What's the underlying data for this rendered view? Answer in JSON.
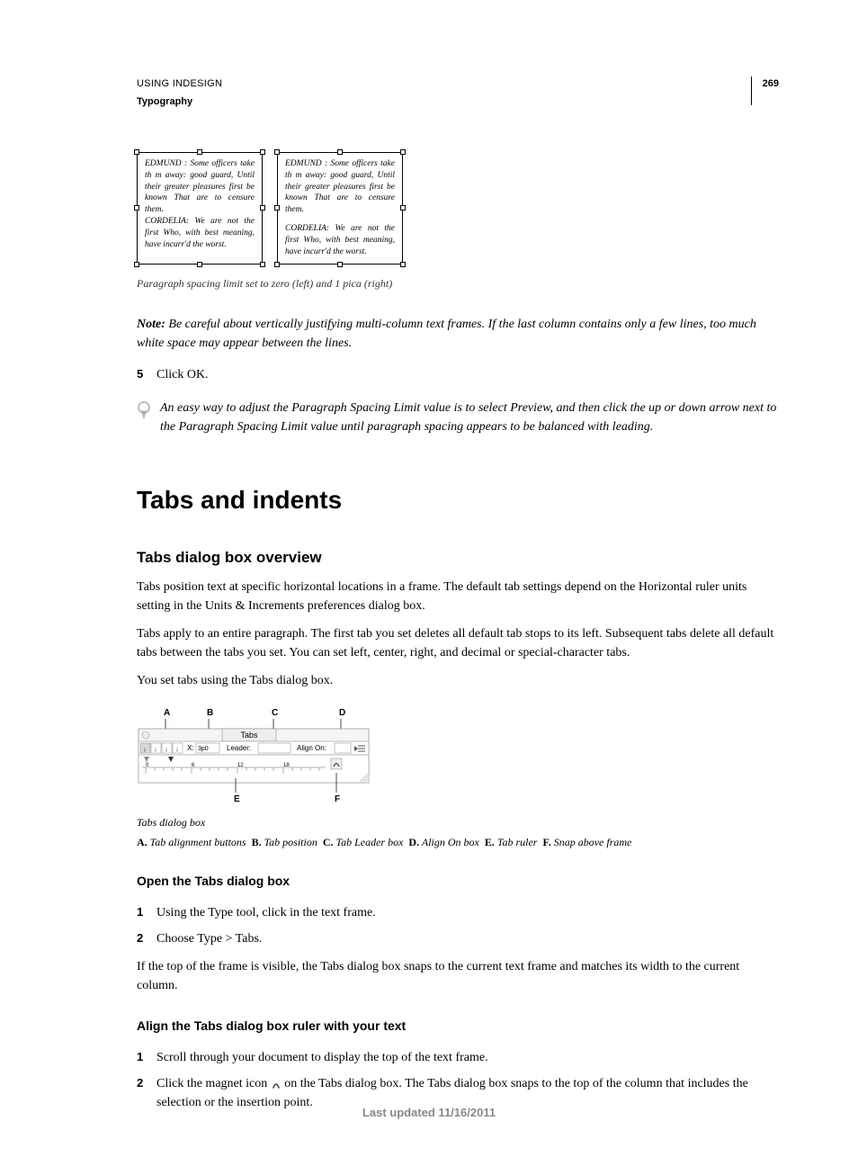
{
  "header": {
    "doc_title": "USING INDESIGN",
    "section_title": "Typography",
    "page_number": "269"
  },
  "figure1": {
    "frame1_text": "EDMUND : Some officers take th m away: good guard, Until their greater pleasures first be known That are to censure them.\nCORDELIA: We are not the first Who, with best meaning, have incurr'd the worst.",
    "frame2_para1": "EDMUND : Some officers take th m away: good guard, Until their greater pleasures first be known That are to censure them.",
    "frame2_para2": "CORDELIA: We are not the first Who, with best meaning, have incurr'd the worst.",
    "caption": "Paragraph spacing limit set to zero (left) and 1 pica (right)"
  },
  "note": {
    "label": "Note:",
    "text": "Be careful about vertically justifying multi-column text frames. If the last column contains only a few lines, too much white space may appear between the lines."
  },
  "step5": {
    "num": "5",
    "text": "Click OK."
  },
  "tip": {
    "text": "An easy way to adjust the Paragraph Spacing Limit value is to select Preview, and then click the up or down arrow next to the Paragraph Spacing Limit value until paragraph spacing appears to be balanced with leading."
  },
  "h1": "Tabs and indents",
  "h2_1": "Tabs dialog box overview",
  "p_overview_1": "Tabs position text at specific horizontal locations in a frame. The default tab settings depend on the Horizontal ruler units setting in the Units & Increments preferences dialog box.",
  "p_overview_2": "Tabs apply to an entire paragraph. The first tab you set deletes all default tab stops to its left. Subsequent tabs delete all default tabs between the tabs you set. You can set left, center, right, and decimal or special-character tabs.",
  "p_overview_3": "You set tabs using the Tabs dialog box.",
  "tabs_fig": {
    "labels": {
      "A": "A",
      "B": "B",
      "C": "C",
      "D": "D",
      "E": "E",
      "F": "F"
    },
    "title": "Tabs",
    "x_value": "3p0",
    "leader_label": "Leader:",
    "align_label": "Align On:",
    "ruler_marks": [
      "0",
      "6",
      "12",
      "18"
    ],
    "caption": "Tabs dialog box",
    "legend_A_label": "A.",
    "legend_A_text": "Tab alignment buttons",
    "legend_B_label": "B.",
    "legend_B_text": "Tab position",
    "legend_C_label": "C.",
    "legend_C_text": "Tab Leader box",
    "legend_D_label": "D.",
    "legend_D_text": "Align On box",
    "legend_E_label": "E.",
    "legend_E_text": "Tab ruler",
    "legend_F_label": "F.",
    "legend_F_text": "Snap above frame"
  },
  "h3_1": "Open the Tabs dialog box",
  "open_steps": [
    {
      "num": "1",
      "text": "Using the Type tool, click in the text frame."
    },
    {
      "num": "2",
      "text": "Choose Type > Tabs."
    }
  ],
  "p_open": "If the top of the frame is visible, the Tabs dialog box snaps to the current text frame and matches its width to the current column.",
  "h3_2": "Align the Tabs dialog box ruler with your text",
  "align_steps": [
    {
      "num": "1",
      "text": "Scroll through your document to display the top of the text frame."
    },
    {
      "num": "2",
      "text_before": "Click the magnet icon ",
      "text_after": " on the Tabs dialog box. The Tabs dialog box snaps to the top of the column that includes the selection or the insertion point."
    }
  ],
  "footer": "Last updated 11/16/2011"
}
